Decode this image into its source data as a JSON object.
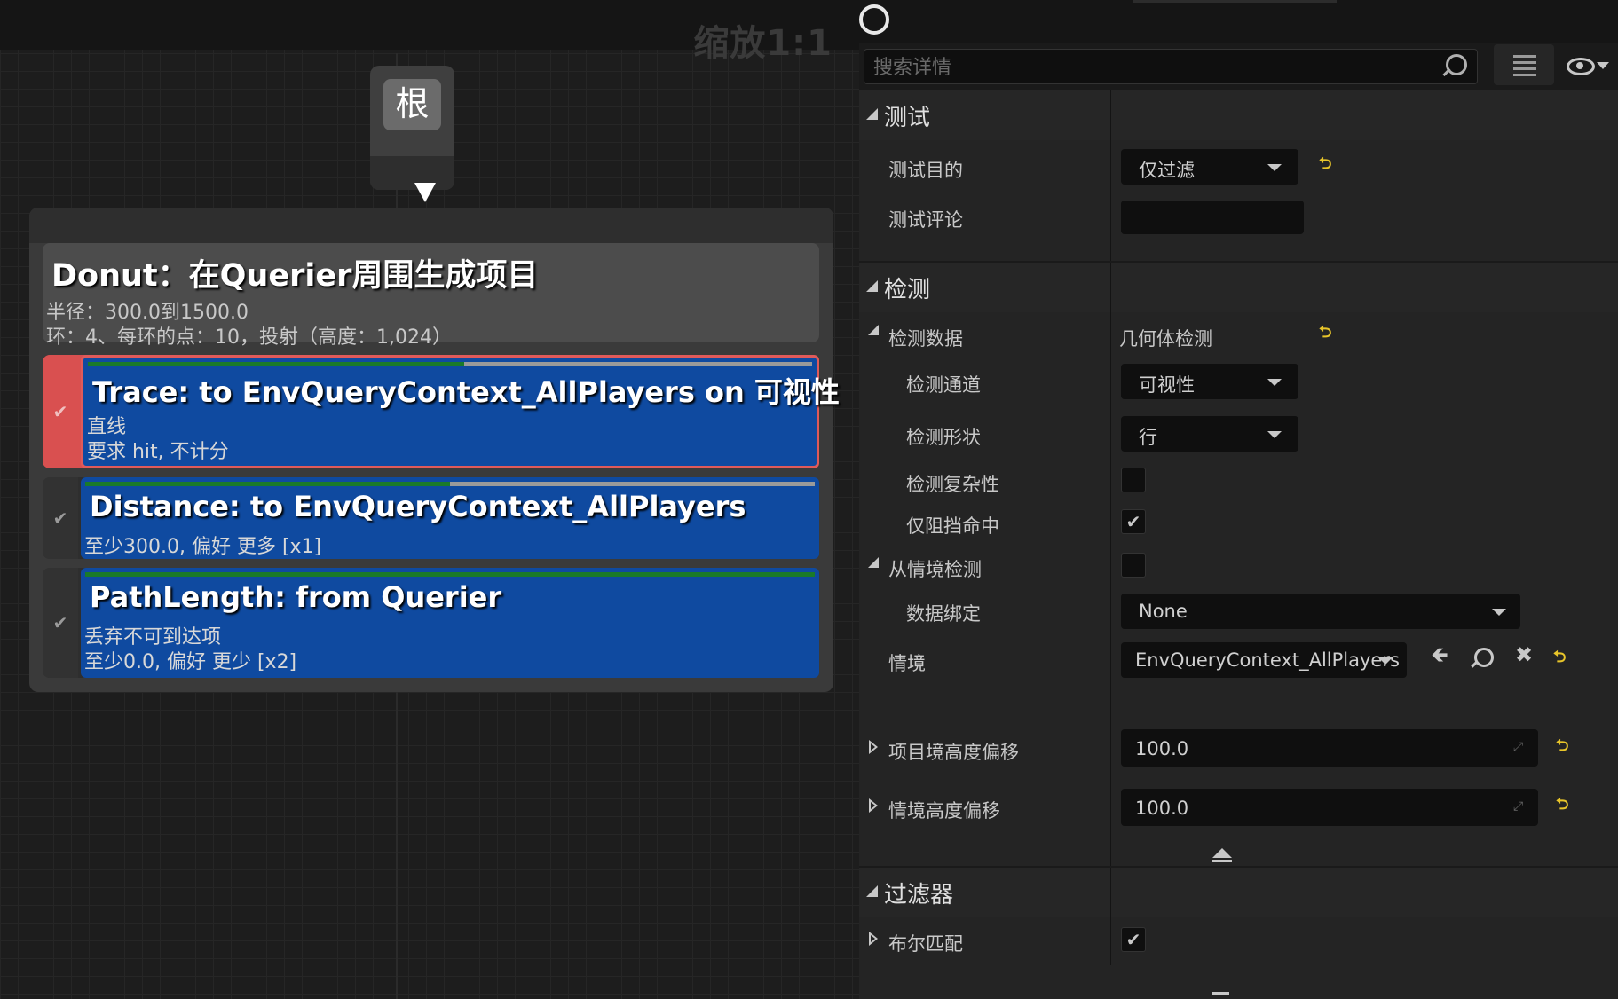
{
  "graph": {
    "zoom_label": "缩放1:1",
    "root_label": "根",
    "generator": {
      "title": "Donut：在Querier周围生成项目",
      "line1": "半径：300.0到1500.0",
      "line2": "环：4、每环的点：10，投射（高度：1,024）"
    },
    "tests": [
      {
        "title": "Trace: to EnvQueryContext_AllPlayers on 可视性",
        "line1": "直线",
        "line2": "要求 hit, 不计分",
        "selected": true
      },
      {
        "title": "Distance: to EnvQueryContext_AllPlayers",
        "line1": "至少300.0, 偏好 更多 [x1]",
        "line2": ""
      },
      {
        "title": "PathLength: from Querier",
        "line1": "丢弃不可到达项",
        "line2": "至少0.0, 偏好 更少 [x2]"
      }
    ]
  },
  "details": {
    "search_placeholder": "搜索详情",
    "sections": {
      "test": {
        "title": "测试",
        "purpose_label": "测试目的",
        "purpose_value": "仅过滤",
        "comment_label": "测试评论",
        "comment_value": ""
      },
      "trace": {
        "title": "检测",
        "data_label": "检测数据",
        "data_value": "几何体检测",
        "channel_label": "检测通道",
        "channel_value": "可视性",
        "shape_label": "检测形状",
        "shape_value": "行",
        "complex_label": "检测复杂性",
        "complex_checked": false,
        "block_label": "仅阻挡命中",
        "block_checked": true,
        "from_context_label": "从情境检测",
        "from_context_checked": false,
        "binding_label": "数据绑定",
        "binding_value": "None",
        "context_label": "情境",
        "context_value": "EnvQueryContext_AllPlayers",
        "item_offset_label": "项目境高度偏移",
        "item_offset_value": "100.0",
        "context_offset_label": "情境高度偏移",
        "context_offset_value": "100.0"
      },
      "filter": {
        "title": "过滤器",
        "bool_label": "布尔匹配",
        "bool_checked": true
      }
    },
    "icons": {
      "reset": "reset-arrow-icon",
      "search": "search-icon",
      "eye": "eye-icon",
      "grid": "list-view-icon"
    }
  }
}
